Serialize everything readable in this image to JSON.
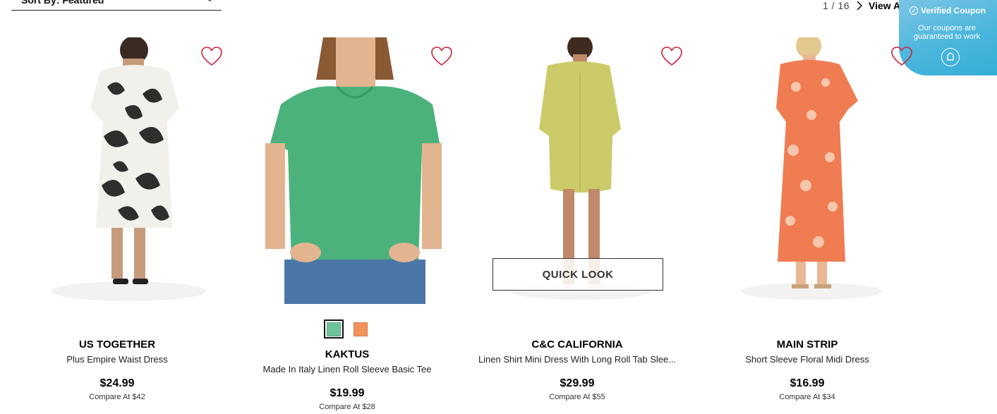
{
  "sort": {
    "label": "Sort By: Featured"
  },
  "pagination": {
    "count": "1 / 16",
    "view_all": "View All"
  },
  "coupon": {
    "title": "Verified Coupon",
    "desc_line1": "Our coupons are",
    "desc_line2": "guaranteed to work"
  },
  "quick_look": "QUICK LOOK",
  "products": [
    {
      "brand": "US TOGETHER",
      "name": "Plus Empire Waist Dress",
      "price": "$24.99",
      "compare": "Compare At  $42"
    },
    {
      "brand": "KAKTUS",
      "name": "Made In Italy Linen Roll Sleeve Basic Tee",
      "price": "$19.99",
      "compare": "Compare At  $28",
      "swatches": [
        {
          "color": "#6ec49a",
          "selected": true
        },
        {
          "color": "#f4925c",
          "selected": false
        }
      ]
    },
    {
      "brand": "C&C CALIFORNIA",
      "name": "Linen Shirt Mini Dress With Long Roll Tab Slee...",
      "price": "$29.99",
      "compare": "Compare At  $55"
    },
    {
      "brand": "MAIN STRIP",
      "name": "Short Sleeve Floral Midi Dress",
      "price": "$16.99",
      "compare": "Compare At  $34"
    }
  ],
  "colors": {
    "heart": "#d0203a",
    "coupon_bg": "#48b5dc"
  }
}
